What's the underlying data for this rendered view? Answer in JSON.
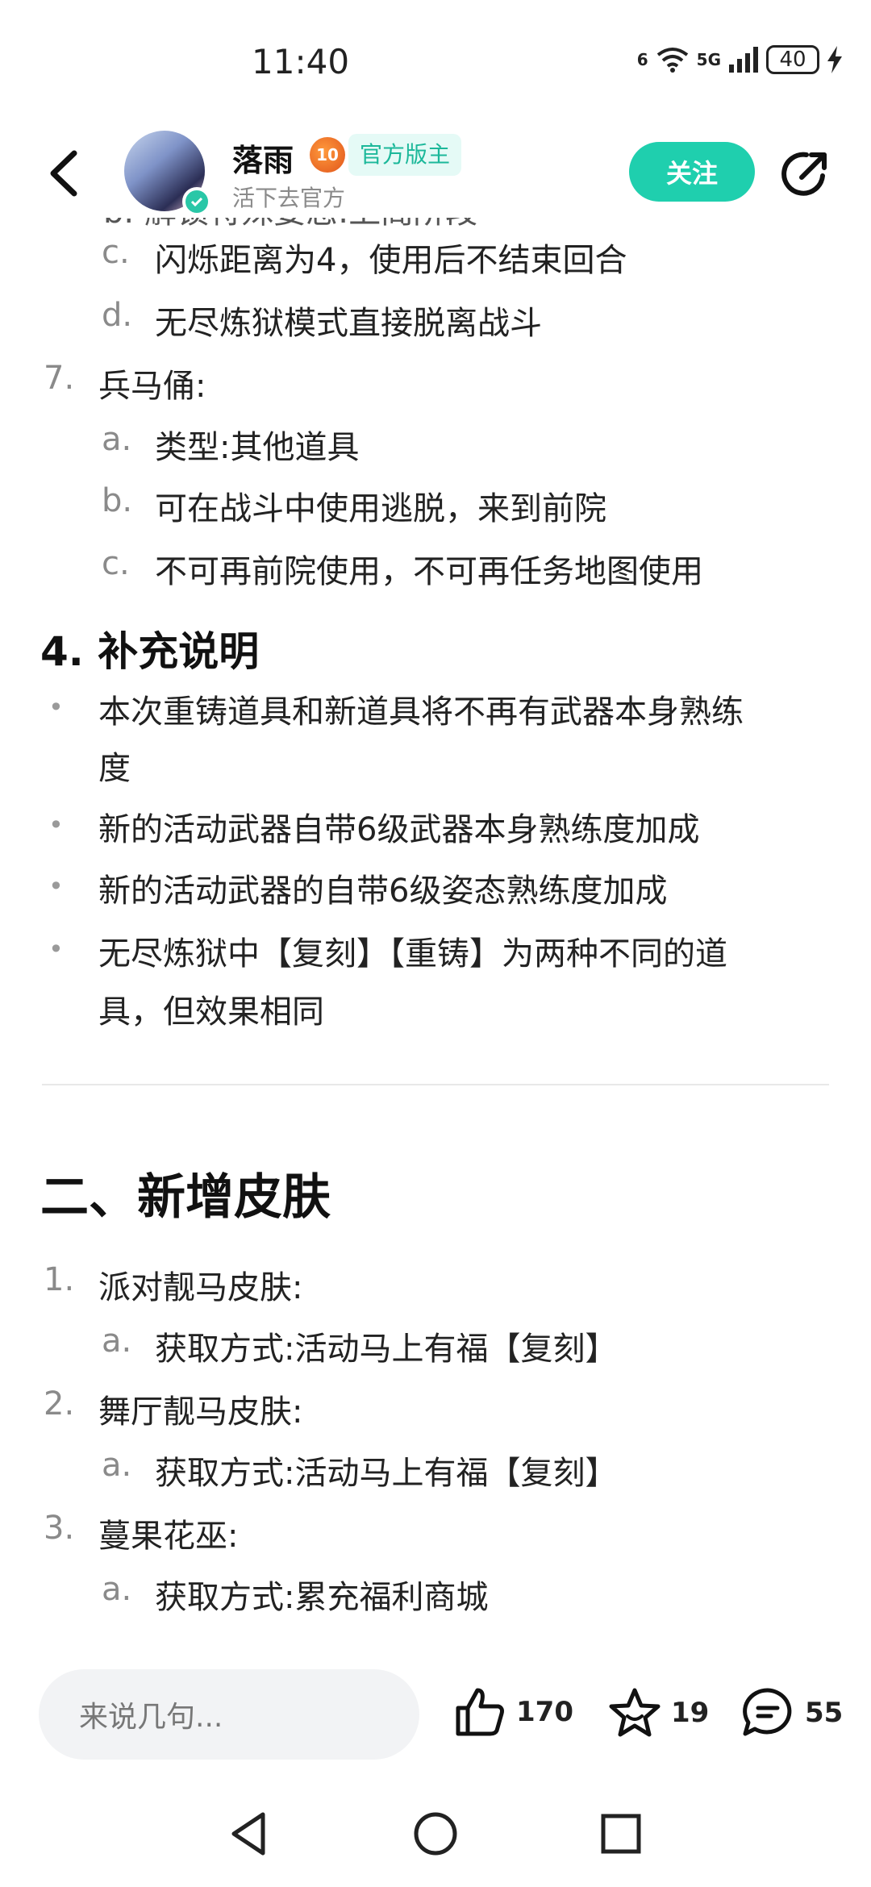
{
  "status_bar": {
    "time": "11:40",
    "network_a": "6",
    "network_b": "5G",
    "battery": "40"
  },
  "header": {
    "author_name": "落雨",
    "level": "10",
    "official_tag": "官方版主",
    "subtitle": "活下去官方",
    "follow_label": "关注"
  },
  "content": {
    "partial_top": "b. 解锁特殊姿态:上阁阶段",
    "list7_items": [
      {
        "marker": "c.",
        "text": "闪烁距离为4，使用后不结束回合"
      },
      {
        "marker": "d.",
        "text": "无尽炼狱模式直接脱离战斗"
      }
    ],
    "item7": {
      "marker": "7.",
      "text": "兵马俑:"
    },
    "item7_sub": [
      {
        "marker": "a.",
        "text": "类型:其他道具"
      },
      {
        "marker": "b.",
        "text": "可在战斗中使用逃脱，来到前院"
      },
      {
        "marker": "c.",
        "text": "不可再前院使用，不可再任务地图使用"
      }
    ],
    "section4_title": "4. 补充说明",
    "section4_bullets": [
      {
        "line1": "本次重铸道具和新道具将不再有武器本身熟练",
        "line2": "度"
      },
      {
        "line1": "新的活动武器自带6级武器本身熟练度加成",
        "line2": ""
      },
      {
        "line1": "新的活动武器的自带6级姿态熟练度加成",
        "line2": ""
      },
      {
        "line1": "无尽炼狱中【复刻】【重铸】为两种不同的道",
        "line2": "具，但效果相同"
      }
    ],
    "section2_title": "二、新增皮肤",
    "skins": [
      {
        "marker": "1.",
        "text": "派对靓马皮肤:",
        "sub_marker": "a.",
        "sub_text": "获取方式:活动马上有福【复刻】"
      },
      {
        "marker": "2.",
        "text": "舞厅靓马皮肤:",
        "sub_marker": "a.",
        "sub_text": "获取方式:活动马上有福【复刻】"
      },
      {
        "marker": "3.",
        "text": "蔓果花巫:",
        "sub_marker": "a.",
        "sub_text": "获取方式:累充福利商城"
      }
    ]
  },
  "bottom_bar": {
    "comment_placeholder": "来说几句...",
    "likes": "170",
    "favorites": "19",
    "comments": "55"
  },
  "colors": {
    "accent": "#1fcfae",
    "official_bg": "#e5faf6",
    "official_text": "#1cb89a"
  }
}
